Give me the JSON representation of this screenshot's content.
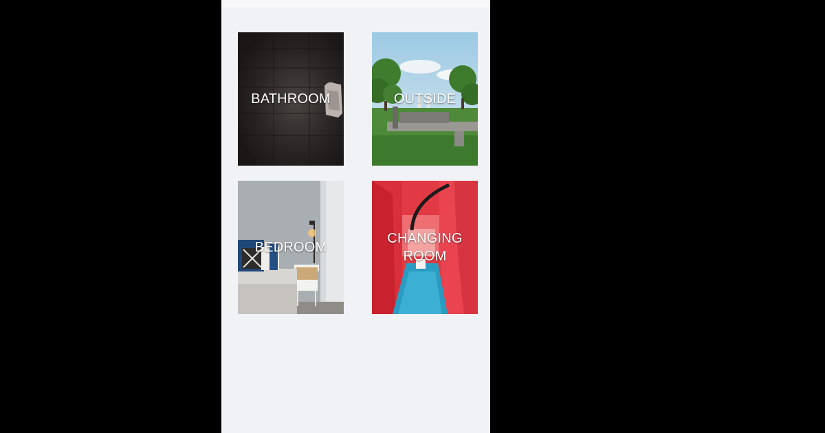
{
  "categories": [
    {
      "label": "BATHROOM"
    },
    {
      "label": "OUTSIDE"
    },
    {
      "label": "BEDROOM"
    },
    {
      "label": "CHANGING\nROOM"
    }
  ],
  "colors": {
    "outer_background": "#000000",
    "app_background": "#f1f2f6",
    "label_text": "#ffffff"
  }
}
